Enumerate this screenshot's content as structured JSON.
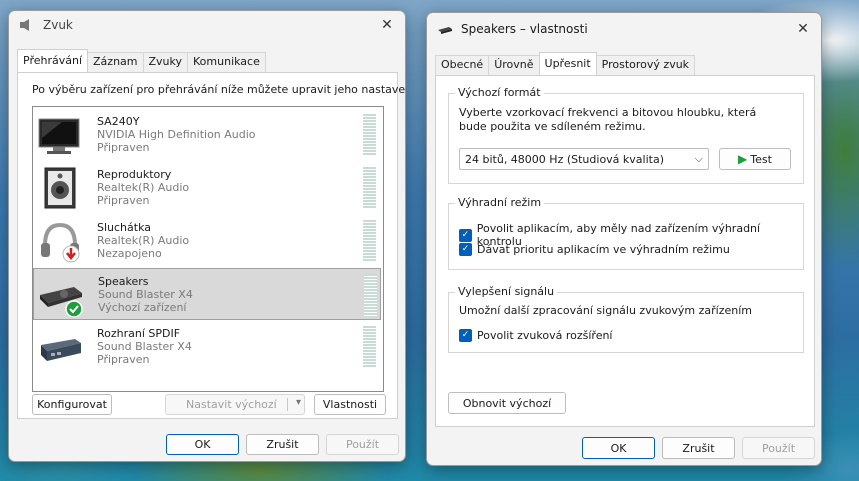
{
  "left_window": {
    "title": "Zvuk",
    "tabs": [
      "Přehrávání",
      "Záznam",
      "Zvuky",
      "Komunikace"
    ],
    "instruction": "Po výběru zařízení pro přehrávání níže můžete upravit jeho nastavení:",
    "devices": [
      {
        "name": "SA240Y",
        "driver": "NVIDIA High Definition Audio",
        "status": "Připraven",
        "icon": "monitor-icon"
      },
      {
        "name": "Reproduktory",
        "driver": "Realtek(R) Audio",
        "status": "Připraven",
        "icon": "speaker-icon"
      },
      {
        "name": "Sluchátka",
        "driver": "Realtek(R) Audio",
        "status": "Nezapojeno",
        "icon": "headphones-icon"
      },
      {
        "name": "Speakers",
        "driver": "Sound Blaster X4",
        "status": "Výchozí zařízení",
        "icon": "sound-card-icon"
      },
      {
        "name": "Rozhraní SPDIF",
        "driver": "Sound Blaster X4",
        "status": "Připraven",
        "icon": "spdif-device-icon"
      }
    ],
    "configure_label": "Konfigurovat",
    "set_default_label": "Nastavit výchozí",
    "properties_label": "Vlastnosti",
    "ok_label": "OK",
    "cancel_label": "Zrušit",
    "apply_label": "Použít"
  },
  "right_window": {
    "title": "Speakers – vlastnosti",
    "tabs": [
      "Obecné",
      "Úrovně",
      "Upřesnit",
      "Prostorový zvuk"
    ],
    "default_format": {
      "label": "Výchozí formát",
      "description": "Vyberte vzorkovací frekvenci a bitovou hloubku, která bude použita ve sdíleném režimu.",
      "selected": "24 bitů, 48000 Hz (Studiová kvalita)",
      "test_label": "Test"
    },
    "exclusive_mode": {
      "label": "Výhradní režim",
      "options": [
        {
          "label": "Povolit aplikacím, aby měly nad zařízením výhradní kontrolu",
          "checked": true
        },
        {
          "label": "Dávat prioritu aplikacím ve výhradním režimu",
          "checked": true
        }
      ]
    },
    "enhancements": {
      "label": "Vylepšení signálu",
      "description": "Umožní další zpracování signálu zvukovým zařízením",
      "option": {
        "label": "Povolit zvuková rozšíření",
        "checked": true
      }
    },
    "restore_defaults_label": "Obnovit výchozí",
    "ok_label": "OK",
    "cancel_label": "Zrušit",
    "apply_label": "Použít"
  },
  "colors": {
    "accent": "#005fb8",
    "selection": "#d9d9d9",
    "test_green": "#1e9e3c"
  }
}
